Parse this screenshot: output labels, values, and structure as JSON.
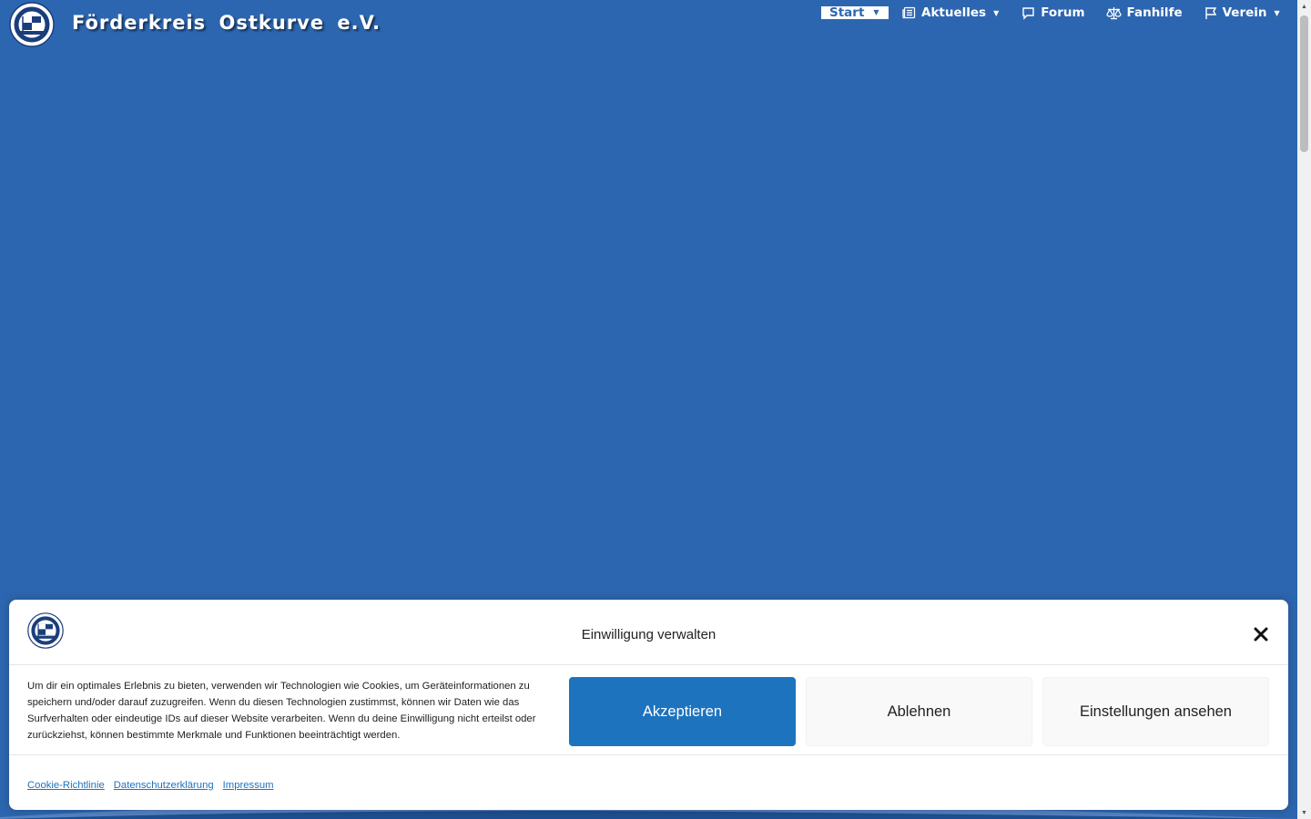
{
  "site": {
    "title": "Förderkreis Ostkurve e.V.",
    "logo_icon": "ostkurve-club-logo"
  },
  "nav": {
    "items": [
      {
        "label": "Start",
        "icon": "none",
        "has_dropdown": true,
        "active": true
      },
      {
        "label": "Aktuelles",
        "icon": "newspaper-icon",
        "has_dropdown": true
      },
      {
        "label": "Forum",
        "icon": "chat-bubble-icon",
        "has_dropdown": false
      },
      {
        "label": "Fanhilfe",
        "icon": "scales-icon",
        "has_dropdown": false
      },
      {
        "label": "Verein",
        "icon": "flag-icon",
        "has_dropdown": true
      }
    ]
  },
  "colors": {
    "page_background": "#2d66b0",
    "accent": "#1e73be",
    "nav_active_bg": "#ffffff"
  },
  "cookie_banner": {
    "title": "Einwilligung verwalten",
    "text": "Um dir ein optimales Erlebnis zu bieten, verwenden wir Technologien wie Cookies, um Geräteinformationen zu speichern und/oder darauf zuzugreifen. Wenn du diesen Technologien zustimmst, können wir Daten wie das Surfverhalten oder eindeutige IDs auf dieser Website verarbeiten. Wenn du deine Einwilligung nicht erteilst oder zurückziehst, können bestimmte Merkmale und Funktionen beeinträchtigt werden.",
    "buttons": {
      "accept": "Akzeptieren",
      "deny": "Ablehnen",
      "settings": "Einstellungen ansehen"
    },
    "links": {
      "cookie_policy": "Cookie-Richtlinie",
      "privacy": "Datenschutzerklärung",
      "imprint": "Impressum"
    },
    "close_icon": "close-x-icon"
  }
}
